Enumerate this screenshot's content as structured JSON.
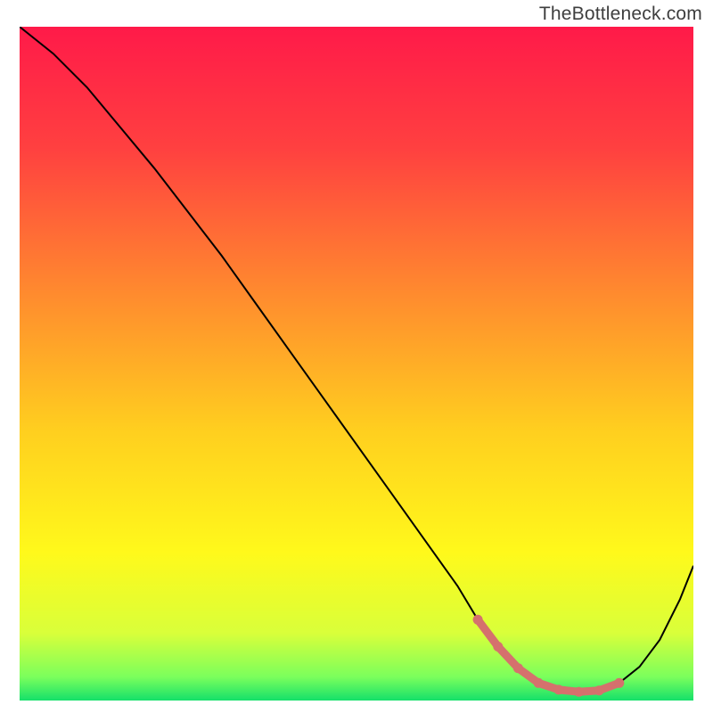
{
  "watermark": "TheBottleneck.com",
  "chart_data": {
    "type": "line",
    "title": "",
    "xlabel": "",
    "ylabel": "",
    "xlim": [
      0,
      100
    ],
    "ylim": [
      0,
      100
    ],
    "grid": false,
    "background_gradient": {
      "stops": [
        {
          "offset": 0.0,
          "color": "#ff1a49"
        },
        {
          "offset": 0.18,
          "color": "#ff4040"
        },
        {
          "offset": 0.4,
          "color": "#ff8c2e"
        },
        {
          "offset": 0.6,
          "color": "#ffcf1f"
        },
        {
          "offset": 0.78,
          "color": "#fff91b"
        },
        {
          "offset": 0.9,
          "color": "#d9ff3a"
        },
        {
          "offset": 0.965,
          "color": "#7bff5c"
        },
        {
          "offset": 1.0,
          "color": "#15e06a"
        }
      ]
    },
    "series": [
      {
        "name": "bottleneck-curve",
        "color": "#000000",
        "x": [
          0,
          5,
          10,
          15,
          20,
          25,
          30,
          35,
          40,
          45,
          50,
          55,
          60,
          65,
          68,
          71,
          74,
          77,
          80,
          83,
          86,
          89,
          92,
          95,
          98,
          100
        ],
        "values": [
          100,
          96,
          91,
          85,
          79,
          72.5,
          66,
          59,
          52,
          45,
          38,
          31,
          24,
          17,
          12,
          8,
          4.8,
          2.6,
          1.6,
          1.3,
          1.5,
          2.6,
          5.0,
          9.0,
          15,
          20
        ]
      }
    ],
    "highlight": {
      "name": "sweet-spot",
      "color": "#d5716d",
      "x": [
        68,
        71,
        74,
        77,
        80,
        83,
        86,
        89
      ],
      "values": [
        12,
        8,
        4.8,
        2.6,
        1.6,
        1.3,
        1.5,
        2.6
      ]
    }
  }
}
